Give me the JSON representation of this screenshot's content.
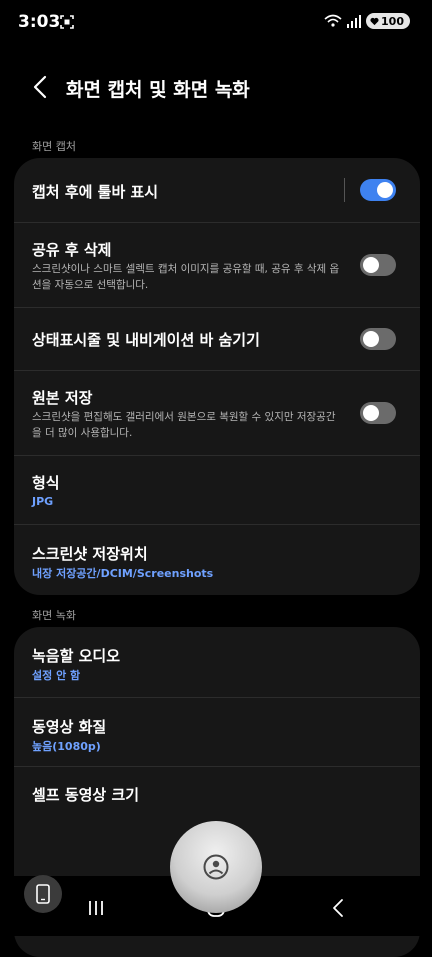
{
  "status_bar": {
    "time": "3:03",
    "battery": "100"
  },
  "header": {
    "title": "화면 캡처 및 화면 녹화"
  },
  "sections": {
    "capture_label": "화면 캡처",
    "record_label": "화면 녹화"
  },
  "capture": {
    "toolbar_after_capture": {
      "title": "캡처 후에 툴바 표시",
      "enabled": true
    },
    "delete_after_share": {
      "title": "공유 후 삭제",
      "desc": "스크린샷이나 스마트 셀렉트 캡처 이미지를 공유할 때, 공유 후 삭제 옵션을 자동으로 선택합니다.",
      "enabled": false
    },
    "hide_bars": {
      "title": "상태표시줄 및 내비게이션 바 숨기기",
      "enabled": false
    },
    "save_original": {
      "title": "원본 저장",
      "desc": "스크린샷을 편집해도 갤러리에서 원본으로 복원할 수 있지만 저장공간을 더 많이 사용합니다.",
      "enabled": false
    },
    "format": {
      "title": "형식",
      "value": "JPG"
    },
    "save_location": {
      "title": "스크린샷 저장위치",
      "value": "내장 저장공간/DCIM/Screenshots"
    }
  },
  "record": {
    "audio": {
      "title": "녹음할 오디오",
      "value": "설정 안 함"
    },
    "video_quality": {
      "title": "동영상 화질",
      "value": "높음(1080p)"
    },
    "selfie_size": {
      "title": "셀프 동영상 크기"
    }
  },
  "colors": {
    "accent": "#3e82f0",
    "value_text": "#6fa1ff",
    "card_bg": "#171717"
  }
}
